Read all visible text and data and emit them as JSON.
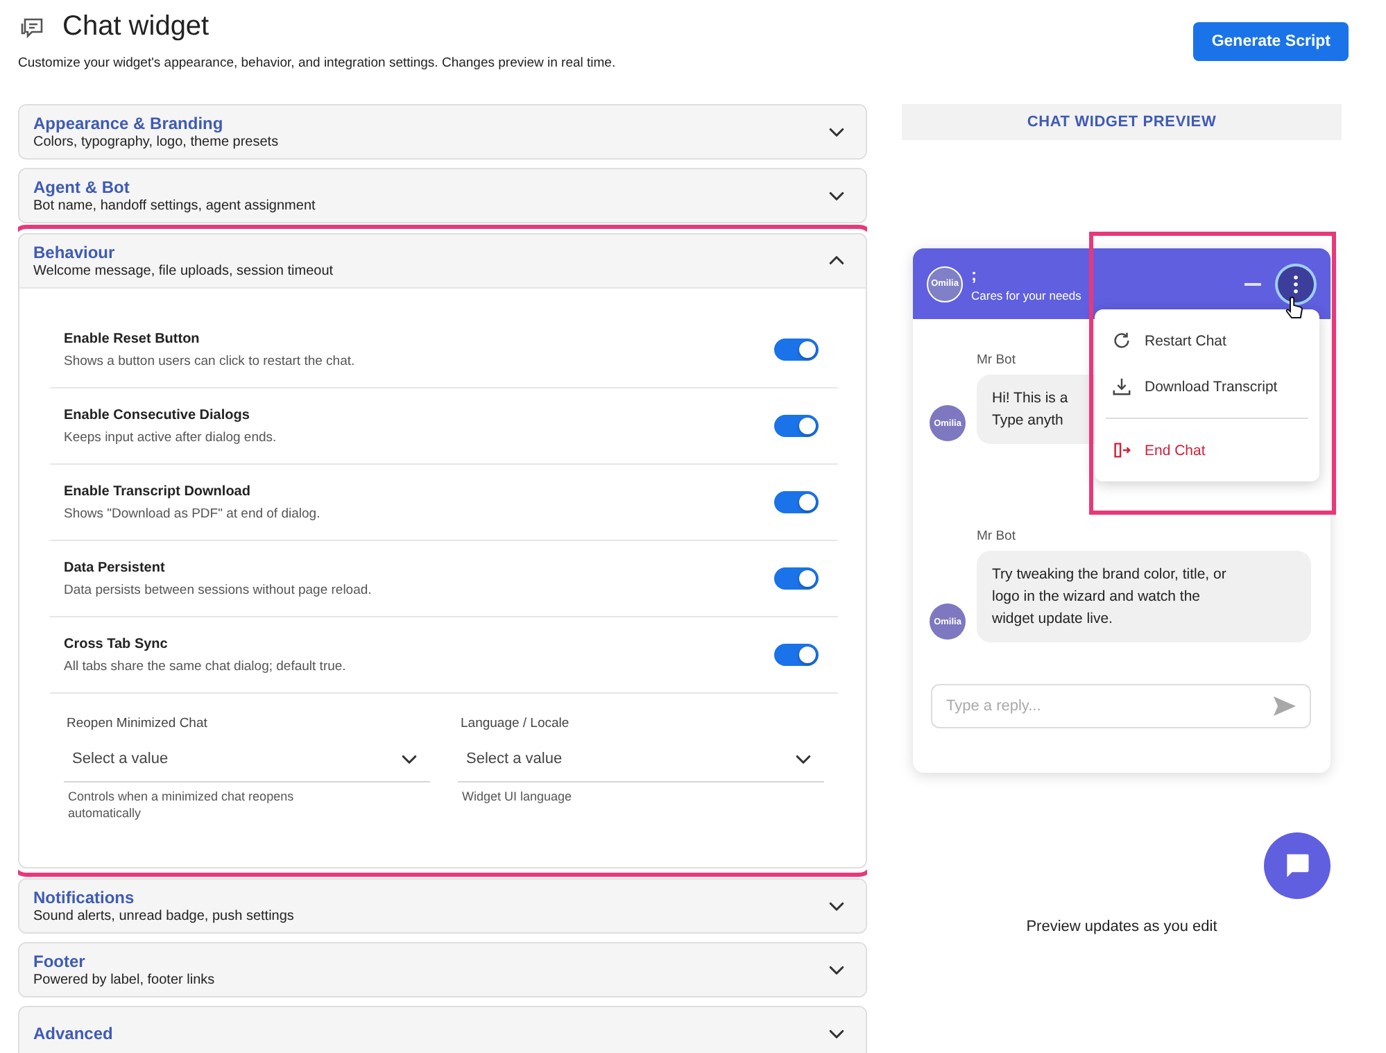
{
  "page": {
    "title": "Chat widget",
    "subtitle": "Customize your widget's appearance, behavior, and integration settings. Changes preview in real time.",
    "generate_button": "Generate Script"
  },
  "sections": [
    {
      "title": "Appearance & Branding",
      "subtitle": "Colors, typography, logo, theme presets",
      "expanded": false,
      "highlighted": false
    },
    {
      "title": "Agent & Bot",
      "subtitle": "Bot name, handoff settings, agent assignment",
      "expanded": false,
      "highlighted": false
    },
    {
      "title": "Behaviour",
      "subtitle": "Welcome message, file uploads, session timeout",
      "expanded": true,
      "highlighted": true,
      "settings": [
        {
          "label": "Enable Reset Button",
          "description": "Shows a button users can click to restart the chat.",
          "on": true
        },
        {
          "label": "Enable Consecutive Dialogs",
          "description": "Keeps input active after dialog ends.",
          "on": true
        },
        {
          "label": "Enable Transcript Download",
          "description": "Shows \"Download as PDF\" at end of dialog.",
          "on": true
        },
        {
          "label": "Data Persistent",
          "description": "Data persists between sessions without page reload.",
          "on": true
        },
        {
          "label": "Cross Tab Sync",
          "description": "All tabs share the same chat dialog; default true.",
          "on": true
        }
      ],
      "selects": [
        {
          "label": "Reopen Minimized Chat",
          "placeholder": "Select a value",
          "help": "Controls when a minimized chat reopens automatically"
        },
        {
          "label": "Language / Locale",
          "placeholder": "Select a value",
          "help": "Widget UI language"
        }
      ]
    },
    {
      "title": "Notifications",
      "subtitle": "Sound alerts, unread badge, push settings",
      "expanded": false,
      "highlighted": false
    },
    {
      "title": "Footer",
      "subtitle": "Powered by label, footer links",
      "expanded": false,
      "highlighted": false
    },
    {
      "title": "Advanced",
      "expanded": false,
      "highlighted": false
    }
  ],
  "preview": {
    "heading": "CHAT WIDGET PREVIEW",
    "chat": {
      "avatar_text": "Omilia",
      "title": ";",
      "tagline": "Cares for your needs",
      "messages": [
        {
          "sender": "Mr Bot",
          "avatar_text": "Omilia",
          "lines": [
            "Hi! This is a",
            "Type anyth"
          ]
        },
        {
          "sender": "Mr Bot",
          "avatar_text": "Omilia",
          "lines": [
            "Try tweaking the brand color, title, or",
            "logo in the wizard and watch the",
            "widget update live."
          ]
        }
      ],
      "reply_placeholder": "Type a reply...",
      "menu": {
        "open": true,
        "highlighted": true,
        "items": [
          {
            "label": "Restart Chat",
            "kind": "restart"
          },
          {
            "label": "Download Transcript",
            "kind": "download"
          },
          {
            "label": "End Chat",
            "kind": "end"
          }
        ]
      }
    },
    "footer_note": "Preview updates as you edit"
  }
}
